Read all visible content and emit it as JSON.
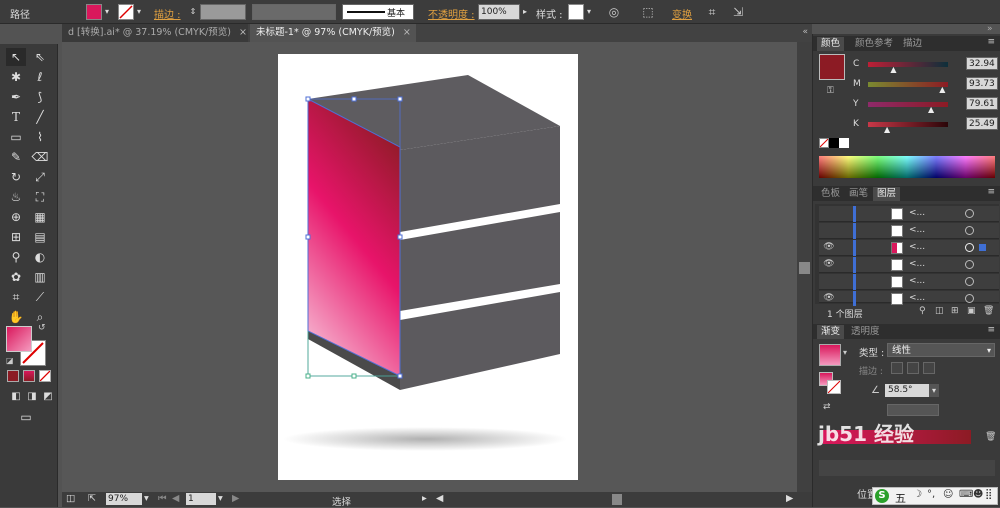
{
  "control_bar": {
    "object_type": "路径",
    "stroke_label": "描边 :",
    "stroke_style": "基本",
    "opacity_label": "不透明度 :",
    "opacity_value": "100%",
    "style_label": "样式 :",
    "transform_label": "变换",
    "fill_color": "#d9185c"
  },
  "tabs": [
    {
      "label": "d [转换].ai* @ 37.19% (CMYK/预览)",
      "close": "×"
    },
    {
      "label": "未标题-1* @ 97% (CMYK/预览)",
      "close": "×"
    }
  ],
  "tools": {
    "fill_gradient": [
      "#d9185c",
      "#f59abf"
    ]
  },
  "color_panel": {
    "tabs": [
      "颜色",
      "颜色参考",
      "描边"
    ],
    "swatch": "#8c1b24",
    "channels": [
      {
        "label": "C",
        "value": "32.94"
      },
      {
        "label": "M",
        "value": "93.73"
      },
      {
        "label": "Y",
        "value": "79.61"
      },
      {
        "label": "K",
        "value": "25.49"
      }
    ],
    "channel_levels": [
      0.33,
      0.94,
      0.8,
      0.25
    ]
  },
  "layers_panel": {
    "tabs": [
      "色板",
      "画笔",
      "图层"
    ],
    "rows": [
      {
        "name": "<...",
        "visible": false
      },
      {
        "name": "<...",
        "visible": false
      },
      {
        "name": "<...",
        "visible": true,
        "selected": true
      },
      {
        "name": "<...",
        "visible": true
      },
      {
        "name": "<...",
        "visible": false
      },
      {
        "name": "<...",
        "visible": true
      }
    ],
    "footer": "1 个图层"
  },
  "gradient_panel": {
    "tabs": [
      "渐变",
      "透明度"
    ],
    "type_label": "类型 :",
    "type_value": "线性",
    "stroke_label": "描边 :",
    "angle": "58.5°",
    "gradient_from": "#d9185c",
    "gradient_to": "#8c1b24"
  },
  "status_bar": {
    "zoom": "97%",
    "page": "1",
    "tool_status": "选择",
    "position_label": "位置",
    "ime_label": "五"
  },
  "watermark": "jb51 经验"
}
